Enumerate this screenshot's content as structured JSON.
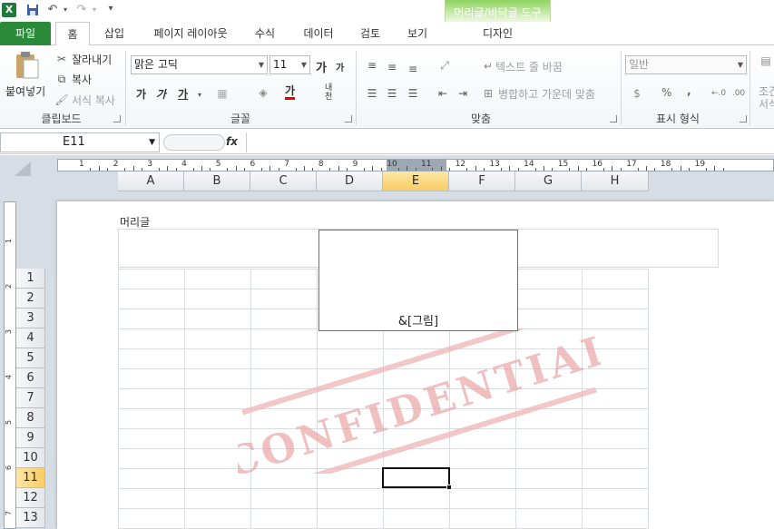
{
  "quick_access": {
    "icons": [
      "excel-icon",
      "save-icon",
      "undo-icon",
      "redo-icon",
      "customize-icon"
    ],
    "excel_letter": "X"
  },
  "contextual": {
    "group_title": "머리글/바닥글 도구",
    "tab": "디자인"
  },
  "tabs": [
    "파일",
    "홈",
    "삽입",
    "페이지 레이아웃",
    "수식",
    "데이터",
    "검토",
    "보기"
  ],
  "ribbon": {
    "clipboard": {
      "paste": "붙여넣기",
      "cut": "잘라내기",
      "copy": "복사",
      "format_painter": "서식 복사",
      "label": "클립보드"
    },
    "font": {
      "name": "맑은 고딕",
      "size": "11",
      "grow": "가",
      "shrink": "가",
      "bold": "가",
      "italic": "가",
      "underline": "가",
      "font_color": "가",
      "phonetic": "내천",
      "label": "글꼴"
    },
    "alignment": {
      "wrap_text": "텍스트 줄 바꿈",
      "merge_center": "병합하고 가운데 맞춤",
      "label": "맞춤"
    },
    "number": {
      "format": "일반",
      "percent": "%",
      "comma": ",",
      "label": "표시 형식"
    },
    "styles": {
      "conditional_1": "조건",
      "conditional_2": "서식"
    }
  },
  "formula_bar": {
    "name_box": "E11",
    "fx": "fx",
    "formula": ""
  },
  "ruler": {
    "h_numbers": [
      "1",
      "2",
      "3",
      "4",
      "5",
      "6",
      "7",
      "8",
      "9",
      "10",
      "11",
      "12",
      "13",
      "14",
      "15",
      "16",
      "17",
      "18",
      "19"
    ],
    "v_numbers": [
      "1",
      "2",
      "3",
      "4",
      "5",
      "6",
      "7"
    ]
  },
  "columns": [
    "A",
    "B",
    "C",
    "D",
    "E",
    "F",
    "G",
    "H"
  ],
  "selected_column": "E",
  "rows": [
    "1",
    "2",
    "3",
    "4",
    "5",
    "6",
    "7",
    "8",
    "9",
    "10",
    "11",
    "12",
    "13"
  ],
  "selected_row": "11",
  "page": {
    "header_label": "머리글",
    "header_picture_code": "&[그림]",
    "watermark_text": "CONFIDENTIAL",
    "watermark_color": "#e8a0a0"
  },
  "colors": {
    "file_tab": "#2a8a3a",
    "contextual": "#8ed35e",
    "selection": "#f8cd62"
  }
}
